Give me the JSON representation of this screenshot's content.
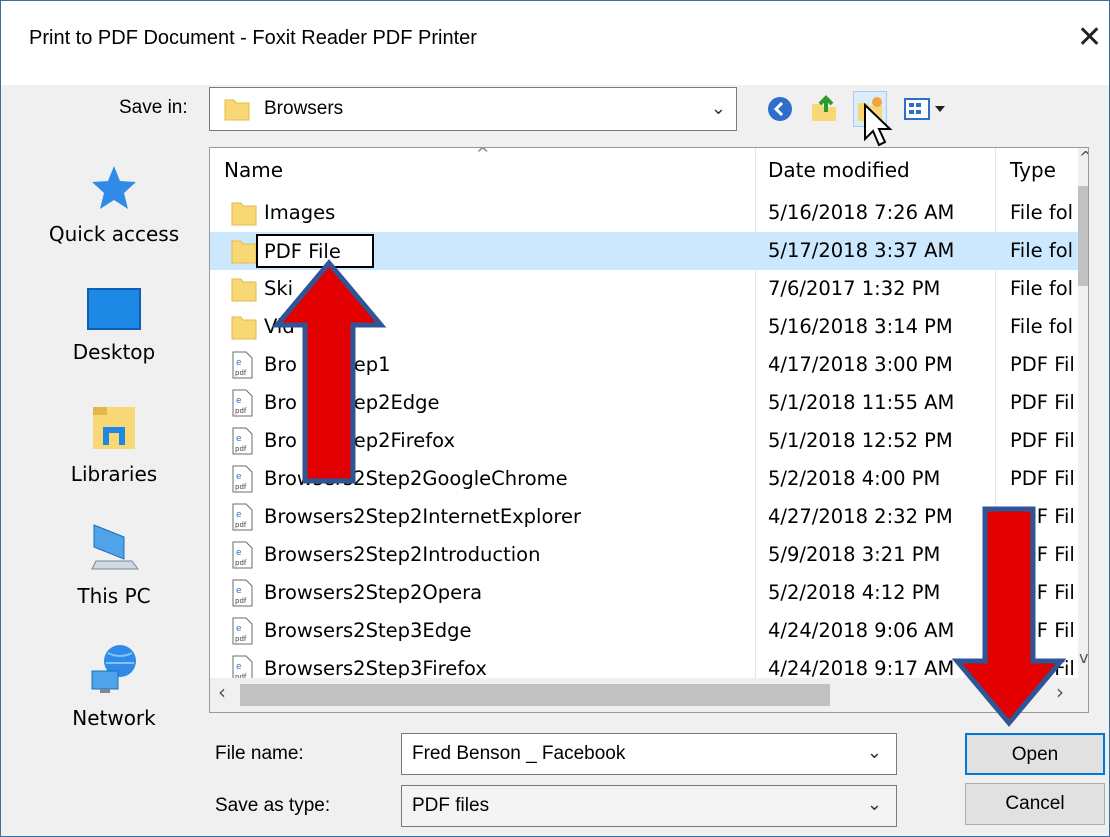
{
  "window": {
    "title": "Print to PDF Document - Foxit Reader PDF Printer",
    "close_glyph": "✕"
  },
  "savein": {
    "label": "Save in:",
    "value": "Browsers"
  },
  "places": [
    {
      "label": "Quick access",
      "icon": "star-icon"
    },
    {
      "label": "Desktop",
      "icon": "desktop-icon"
    },
    {
      "label": "Libraries",
      "icon": "libraries-icon"
    },
    {
      "label": "This PC",
      "icon": "computer-icon"
    },
    {
      "label": "Network",
      "icon": "network-icon"
    }
  ],
  "columns": {
    "name": "Name",
    "date": "Date modified",
    "type": "Type"
  },
  "rows": [
    {
      "name": "Images",
      "date": "5/16/2018 7:26 AM",
      "type": "File fol",
      "kind": "folder"
    },
    {
      "name": "PDF File",
      "date": "5/17/2018 3:37 AM",
      "type": "File fol",
      "kind": "folder",
      "selected": true
    },
    {
      "name": "Ski",
      "date": "7/6/2017 1:32 PM",
      "type": "File fol",
      "kind": "folder"
    },
    {
      "name": "Vid",
      "date": "5/16/2018 3:14 PM",
      "type": "File fol",
      "kind": "folder"
    },
    {
      "name": "Bro    rs2Step1",
      "date": "4/17/2018 3:00 PM",
      "type": "PDF Fil",
      "kind": "pdf"
    },
    {
      "name": "Bro    rs2Step2Edge",
      "date": "5/1/2018 11:55 AM",
      "type": "PDF Fil",
      "kind": "pdf"
    },
    {
      "name": "Bro    rs2Step2Firefox",
      "date": "5/1/2018 12:52 PM",
      "type": "PDF Fil",
      "kind": "pdf"
    },
    {
      "name": "Browsers2Step2GoogleChrome",
      "date": "5/2/2018 4:00 PM",
      "type": "PDF Fil",
      "kind": "pdf"
    },
    {
      "name": "Browsers2Step2InternetExplorer",
      "date": "4/27/2018 2:32 PM",
      "type": "PDF Fil",
      "kind": "pdf"
    },
    {
      "name": "Browsers2Step2Introduction",
      "date": "5/9/2018 3:21 PM",
      "type": "PDF Fil",
      "kind": "pdf"
    },
    {
      "name": "Browsers2Step2Opera",
      "date": "5/2/2018 4:12 PM",
      "type": "PDF Fil",
      "kind": "pdf"
    },
    {
      "name": "Browsers2Step3Edge",
      "date": "4/24/2018 9:06 AM",
      "type": "PDF Fil",
      "kind": "pdf"
    },
    {
      "name": "Browsers2Step3Firefox",
      "date": "4/24/2018 9:17 AM",
      "type": "PDF Fil",
      "kind": "pdf"
    }
  ],
  "filename": {
    "label": "File name:",
    "value": "Fred Benson _ Facebook"
  },
  "savetype": {
    "label": "Save as type:",
    "value": "PDF files"
  },
  "buttons": {
    "open": "Open",
    "cancel": "Cancel"
  },
  "colors": {
    "accent": "#0078d7",
    "selection": "#cce8ff",
    "annotation_arrow": "#e30000",
    "arrow_outline": "#2f5597"
  }
}
